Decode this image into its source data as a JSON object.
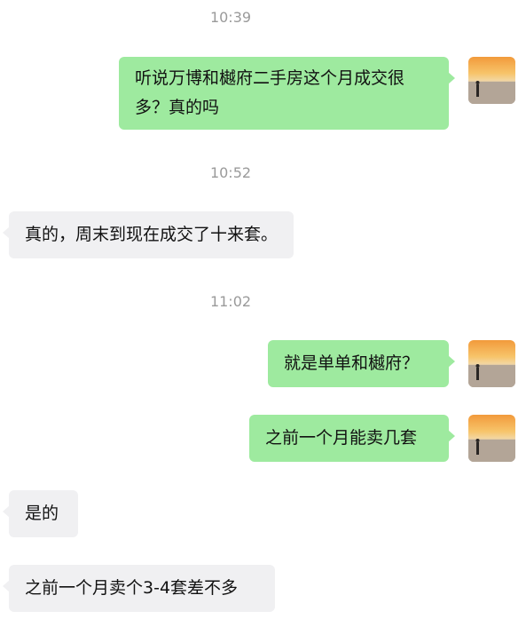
{
  "chat": {
    "timestamps": [
      "10:39",
      "10:52",
      "11:02"
    ],
    "messages": [
      {
        "sender": "me",
        "text": "听说万博和樾府二手房这个月成交很多？真的吗"
      },
      {
        "sender": "other",
        "text": "真的，周末到现在成交了十来套。"
      },
      {
        "sender": "me",
        "text": "就是单单和樾府？"
      },
      {
        "sender": "me",
        "text": "之前一个月能卖几套"
      },
      {
        "sender": "other",
        "text": "是的"
      },
      {
        "sender": "other",
        "text": "之前一个月卖个3-4套差不多"
      }
    ]
  },
  "avatar": {
    "icon": "sunset-beach-person-avatar"
  },
  "colors": {
    "my_bubble": "#9eea9f",
    "other_bubble": "#f0f0f2",
    "timestamp": "#9a9a9a"
  }
}
